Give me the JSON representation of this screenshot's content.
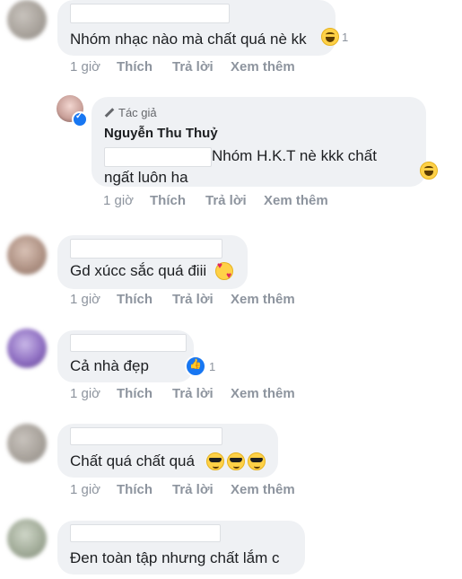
{
  "actions": {
    "time": "1 giờ",
    "like": "Thích",
    "reply": "Trả lời",
    "more": "Xem thêm"
  },
  "comments": [
    {
      "text": "Nhóm nhạc nào mà chất quá nè kk",
      "reaction_icon": "laugh-emoji",
      "reaction_count": "1"
    },
    {
      "author_badge": "Tác giả",
      "author": "Nguyễn Thu Thuỷ",
      "text_line1": "Nhóm H.K.T nè kkk chất",
      "text_line2": "ngất luôn ha",
      "reaction_icon": "laugh-emoji"
    },
    {
      "text": "Gd xúcc sắc quá điii",
      "emoji_icon": "smiling-face-with-hearts-emoji"
    },
    {
      "text": "Cả nhà đẹp",
      "reaction_icon": "like-icon",
      "reaction_count": "1"
    },
    {
      "text": "Chất quá chất quá",
      "emoji_icons": [
        "sunglasses-emoji",
        "sunglasses-emoji",
        "sunglasses-emoji"
      ]
    },
    {
      "text": "Đen toàn tập nhưng chất lắm c"
    }
  ]
}
